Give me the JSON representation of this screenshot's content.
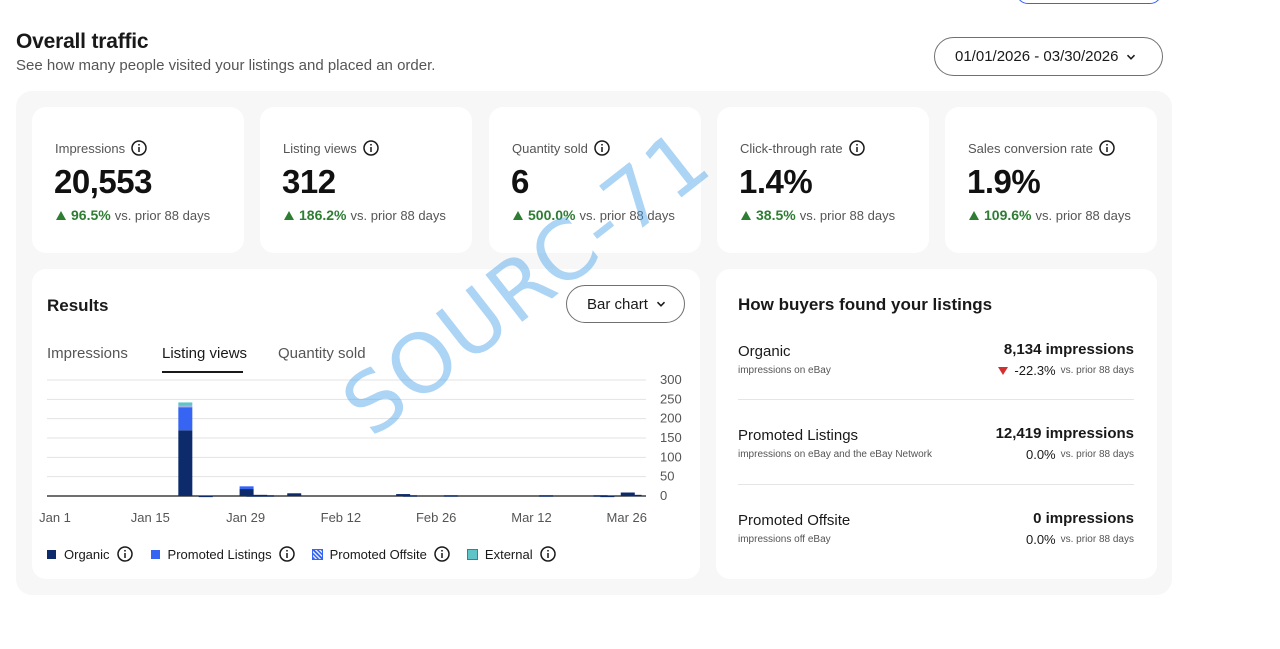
{
  "header": {
    "title": "Overall traffic",
    "subtitle": "See how many people visited your listings and placed an order.",
    "date_range": "01/01/2026 - 03/30/2026"
  },
  "metrics": [
    {
      "label": "Impressions",
      "value": "20,553",
      "change": "96.5%",
      "compare": "vs. prior 88 days"
    },
    {
      "label": "Listing views",
      "value": "312",
      "change": "186.2%",
      "compare": "vs. prior 88 days"
    },
    {
      "label": "Quantity sold",
      "value": "6",
      "change": "500.0%",
      "compare": "vs. prior 88 days"
    },
    {
      "label": "Click-through rate",
      "value": "1.4%",
      "change": "38.5%",
      "compare": "vs. prior 88 days"
    },
    {
      "label": "Sales conversion rate",
      "value": "1.9%",
      "change": "109.6%",
      "compare": "vs. prior 88 days"
    }
  ],
  "results": {
    "title": "Results",
    "chart_type_label": "Bar chart",
    "tabs": [
      {
        "label": "Impressions",
        "active": false
      },
      {
        "label": "Listing views",
        "active": true
      },
      {
        "label": "Quantity sold",
        "active": false
      }
    ],
    "legend": [
      {
        "label": "Organic",
        "color": "#0d2a6b"
      },
      {
        "label": "Promoted Listings",
        "color": "#3665f3"
      },
      {
        "label": "Promoted Offsite",
        "color": "#9fb3e8"
      },
      {
        "label": "External",
        "color": "#5ec4c8"
      }
    ]
  },
  "chart_data": {
    "type": "bar",
    "stacked": true,
    "x_tick_labels": [
      "Jan 1",
      "Jan 15",
      "Jan 29",
      "Feb 12",
      "Feb 26",
      "Mar 12",
      "Mar 26"
    ],
    "y_tick_labels": [
      "300",
      "250",
      "200",
      "150",
      "100",
      "50",
      "0"
    ],
    "ylim": [
      0,
      300
    ],
    "grid": true,
    "y_axis_side": "right",
    "series": [
      {
        "name": "Organic",
        "color": "#0d2a6b",
        "points": [
          [
            19,
            170
          ],
          [
            22,
            1
          ],
          [
            28,
            18
          ],
          [
            29,
            2
          ],
          [
            30,
            3
          ],
          [
            31,
            2
          ],
          [
            35,
            7
          ],
          [
            51,
            5
          ],
          [
            52,
            2
          ],
          [
            58,
            2
          ],
          [
            72,
            2
          ],
          [
            80,
            2
          ],
          [
            81,
            1
          ],
          [
            84,
            9
          ],
          [
            85,
            3
          ]
        ]
      },
      {
        "name": "Promoted Listings",
        "color": "#3665f3",
        "points": [
          [
            19,
            60
          ],
          [
            28,
            7
          ]
        ]
      },
      {
        "name": "Promoted Offsite",
        "color": "#9fb3e8",
        "points": [
          [
            19,
            3
          ]
        ]
      },
      {
        "name": "External",
        "color": "#5ec4c8",
        "points": [
          [
            19,
            9
          ]
        ]
      }
    ],
    "x_domain": [
      0,
      88
    ]
  },
  "buyers": {
    "title": "How buyers found your listings",
    "sources": [
      {
        "name": "Organic",
        "desc": "impressions on eBay",
        "impressions": "8,134 impressions",
        "change": "-22.3%",
        "direction": "down",
        "compare": "vs. prior 88 days"
      },
      {
        "name": "Promoted Listings",
        "desc": "impressions on eBay and the eBay Network",
        "impressions": "12,419 impressions",
        "change": "0.0%",
        "direction": "flat",
        "compare": "vs. prior 88 days"
      },
      {
        "name": "Promoted Offsite",
        "desc": "impressions off eBay",
        "impressions": "0 impressions",
        "change": "0.0%",
        "direction": "flat",
        "compare": "vs. prior 88 days"
      }
    ]
  },
  "watermark": "SOURC-71",
  "icons": {
    "info": "info-icon",
    "chevron": "chevron-down-icon"
  }
}
